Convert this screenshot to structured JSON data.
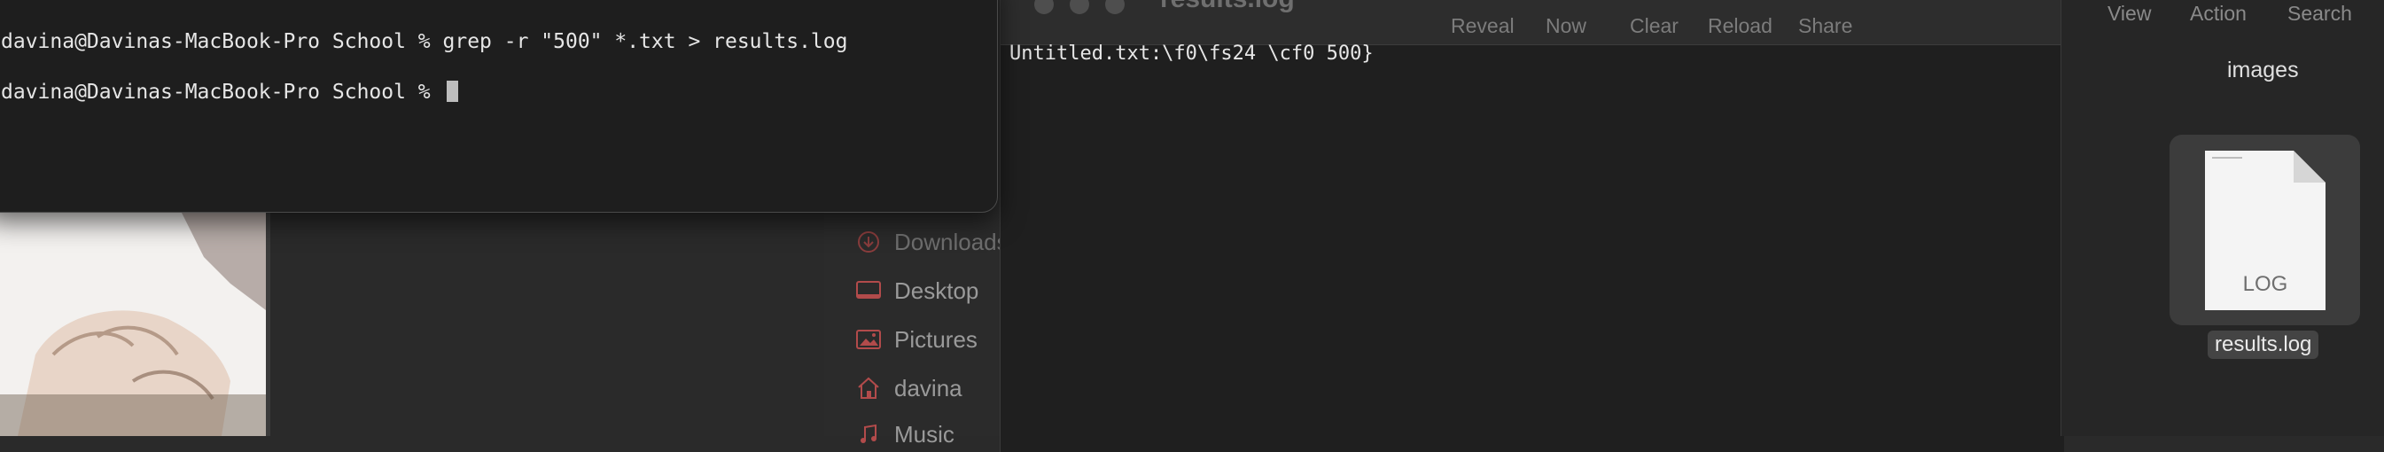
{
  "terminal": {
    "line1": "davina@Davinas-MacBook-Pro School % grep -r \"500\" *.txt > results.log",
    "line2": "davina@Davinas-MacBook-Pro School % "
  },
  "console": {
    "title": "results.log",
    "toolbar": [
      "Reveal",
      "Now",
      "Clear",
      "Reload",
      "Share"
    ],
    "log_line": "Untitled.txt:\\f0\\fs24 \\cf0 500}"
  },
  "sidebar": {
    "items": [
      {
        "label": "Downloads",
        "icon": "download-icon"
      },
      {
        "label": "Desktop",
        "icon": "desktop-icon"
      },
      {
        "label": "Pictures",
        "icon": "pictures-icon"
      },
      {
        "label": "davina",
        "icon": "home-icon"
      },
      {
        "label": "Music",
        "icon": "music-icon"
      }
    ]
  },
  "finder": {
    "toolbar": [
      "View",
      "Action",
      "Search"
    ],
    "folder_title": "images",
    "file": {
      "type_label": "LOG",
      "name": "results.log"
    }
  },
  "colors": {
    "accent_red": "#b24b4b",
    "window_bg": "#1f1f1f"
  }
}
